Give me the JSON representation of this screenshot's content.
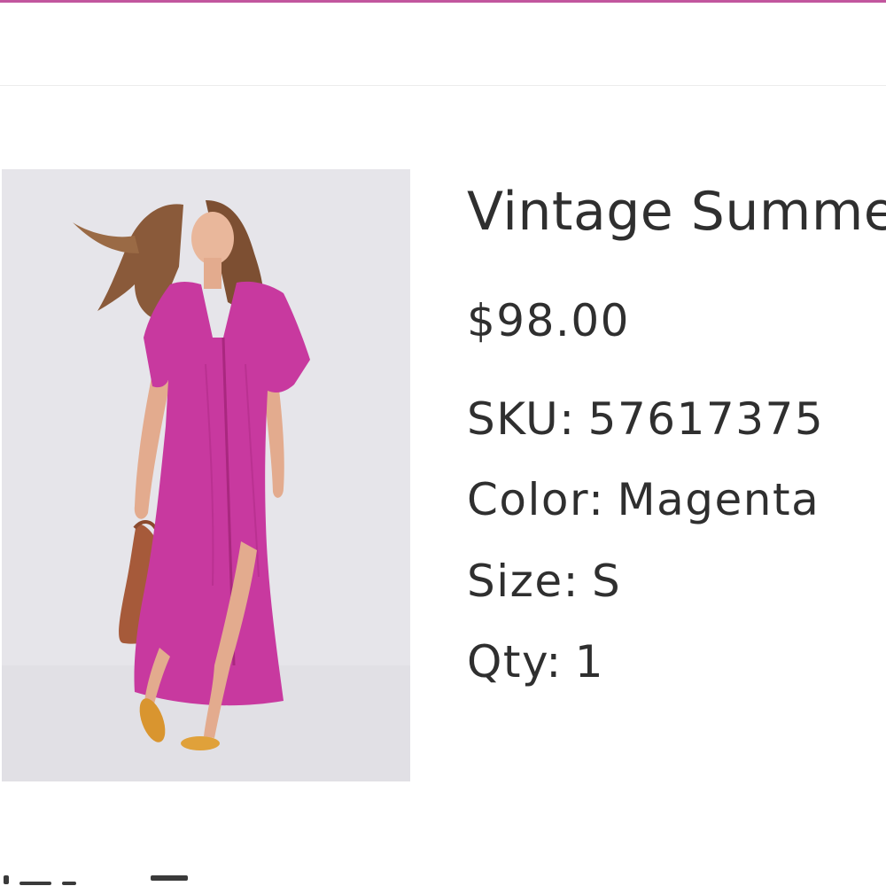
{
  "product": {
    "title": "Vintage Summer",
    "price": "$98.00",
    "sku_label": "SKU:",
    "sku_value": "57617375",
    "color_label": "Color:",
    "color_value": "Magenta",
    "size_label": "Size:",
    "size_value": "S",
    "qty_label": "Qty:",
    "qty_value": "1",
    "image_subject": "model wearing magenta maxi dress with woven bag"
  },
  "colors": {
    "accent": "#c2569e",
    "dress": "#c8399f",
    "text": "#2f2f2f",
    "image_background": "#e6e5ea"
  }
}
